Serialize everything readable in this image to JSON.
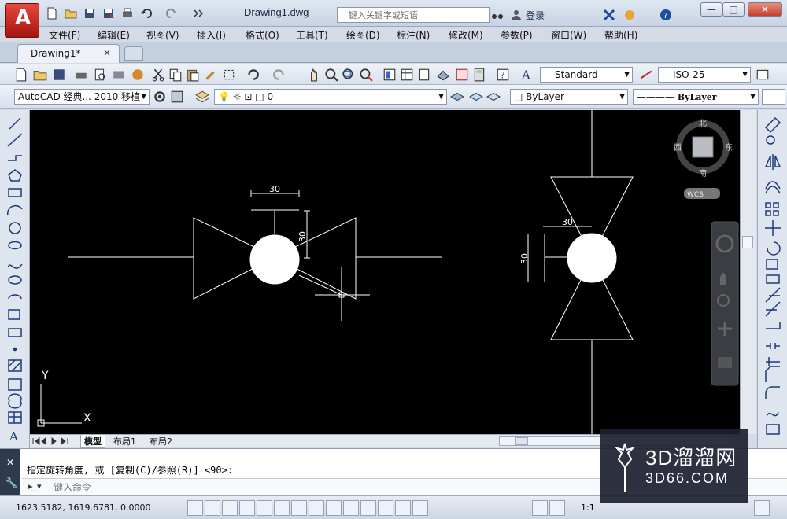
{
  "title": "Drawing1.dwg",
  "search": {
    "placeholder": "键入关键字或短语"
  },
  "login": "登录",
  "window_controls": {
    "minimize": "—",
    "restore": "□",
    "close": "✕"
  },
  "menu": [
    "文件(F)",
    "编辑(E)",
    "视图(V)",
    "插入(I)",
    "格式(O)",
    "工具(T)",
    "绘图(D)",
    "标注(N)",
    "修改(M)",
    "参数(P)",
    "窗口(W)",
    "帮助(H)"
  ],
  "tab": {
    "label": "Drawing1*",
    "close": "×"
  },
  "toolbar": {
    "text_style": "Standard",
    "dim_style": "ISO-25",
    "workspace": "AutoCAD 经典... 2010 移植",
    "layer": "0",
    "color": "ByLayer",
    "linetype": "ByLayer"
  },
  "viewcube": {
    "north": "北",
    "south": "南",
    "east": "东",
    "west": "西",
    "wcs": "WCS"
  },
  "drawing": {
    "dimensions": [
      "30",
      "30",
      "30",
      "30"
    ],
    "axis_y": "Y",
    "axis_x": "X"
  },
  "layout_tabs": [
    "模型",
    "布局1",
    "布局2"
  ],
  "command": {
    "history": "指定旋转角度, 或 [复制(C)/参照(R)] <90>:",
    "placeholder": "键入命令"
  },
  "status": {
    "coords": "1623.5182,  1619.6781, 0.0000",
    "scale": "1:1"
  },
  "watermark": {
    "main": "3D溜溜网",
    "sub": "3D66.COM"
  },
  "colors": {
    "canvas": "#000000",
    "line": "#ffffff",
    "accent": "#c0231b"
  }
}
